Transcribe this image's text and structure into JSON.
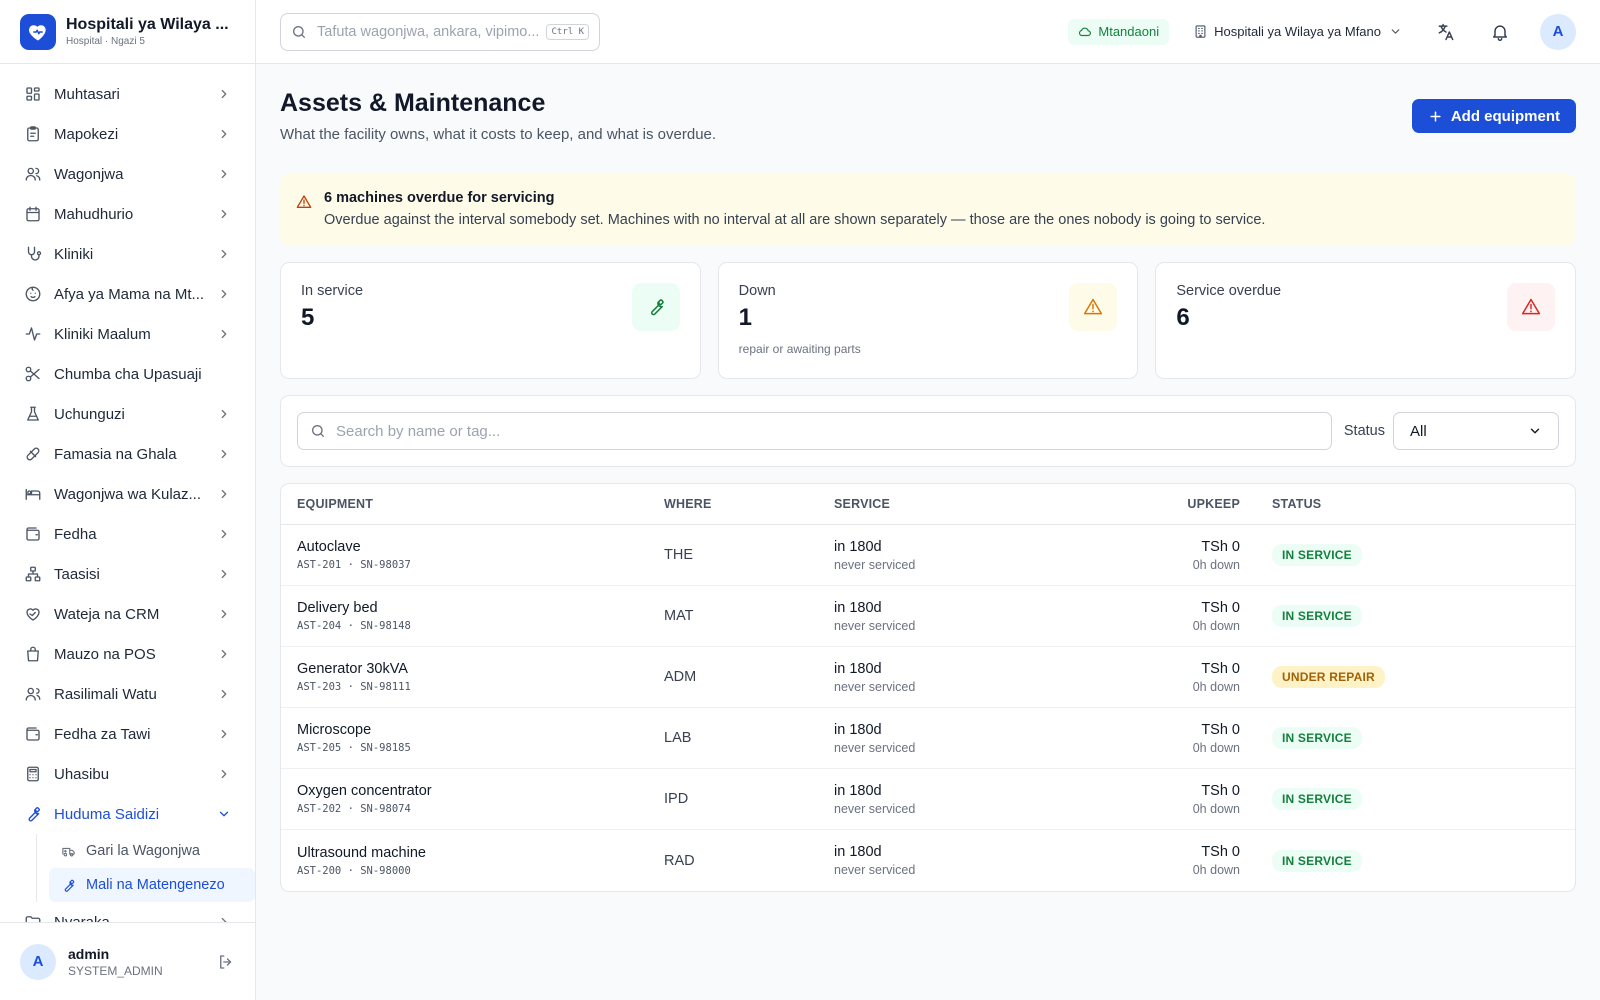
{
  "brand": {
    "title": "Hospitali ya Wilaya ...",
    "subtitle": "Hospital · Ngazi 5"
  },
  "sidebar": {
    "items": [
      {
        "label": "Muhtasari",
        "icon": "dashboard-icon",
        "chevron": true
      },
      {
        "label": "Mapokezi",
        "icon": "clipboard-icon",
        "chevron": true
      },
      {
        "label": "Wagonjwa",
        "icon": "users-icon",
        "chevron": true
      },
      {
        "label": "Mahudhurio",
        "icon": "calendar-icon",
        "chevron": true
      },
      {
        "label": "Kliniki",
        "icon": "stethoscope-icon",
        "chevron": true
      },
      {
        "label": "Afya ya Mama na Mt...",
        "icon": "baby-icon",
        "chevron": true
      },
      {
        "label": "Kliniki Maalum",
        "icon": "activity-icon",
        "chevron": true
      },
      {
        "label": "Chumba cha Upasuaji",
        "icon": "scissors-icon",
        "chevron": false
      },
      {
        "label": "Uchunguzi",
        "icon": "flask-icon",
        "chevron": true
      },
      {
        "label": "Famasia na Ghala",
        "icon": "pill-icon",
        "chevron": true
      },
      {
        "label": "Wagonjwa wa Kulaz...",
        "icon": "bed-icon",
        "chevron": true
      },
      {
        "label": "Fedha",
        "icon": "wallet-icon",
        "chevron": true
      },
      {
        "label": "Taasisi",
        "icon": "network-icon",
        "chevron": true
      },
      {
        "label": "Wateja na CRM",
        "icon": "heart-handshake-icon",
        "chevron": true
      },
      {
        "label": "Mauzo na POS",
        "icon": "shopping-bag-icon",
        "chevron": true
      },
      {
        "label": "Rasilimali Watu",
        "icon": "user-group-icon",
        "chevron": true
      },
      {
        "label": "Fedha za Tawi",
        "icon": "wallet-icon",
        "chevron": true
      },
      {
        "label": "Uhasibu",
        "icon": "calculator-icon",
        "chevron": true
      }
    ],
    "active_group": {
      "label": "Huduma Saidizi",
      "icon": "wrench-icon"
    },
    "sub_items": [
      {
        "label": "Gari la Wagonjwa",
        "icon": "ambulance-icon"
      },
      {
        "label": "Mali na Matengenezo",
        "icon": "wrench-icon",
        "active": true
      }
    ],
    "trailing_item": {
      "label": "Nyaraka",
      "icon": "folder-icon"
    }
  },
  "user": {
    "avatar": "A",
    "name": "admin",
    "role": "SYSTEM_ADMIN"
  },
  "topbar": {
    "search_placeholder": "Tafuta wagonjwa, ankara, vipimo...",
    "shortcut": "Ctrl K",
    "online_label": "Mtandaoni",
    "facility": "Hospitali ya Wilaya ya Mfano",
    "avatar": "A"
  },
  "page": {
    "title": "Assets & Maintenance",
    "subtitle": "What the facility owns, what it costs to keep, and what is overdue.",
    "add_button": "Add equipment"
  },
  "alert": {
    "title": "6 machines overdue for servicing",
    "body": "Overdue against the interval somebody set. Machines with no interval at all are shown separately — those are the ones nobody is going to service."
  },
  "stats": [
    {
      "label": "In service",
      "value": "5",
      "note": "",
      "icon": "wrench-icon",
      "color": "#15803d"
    },
    {
      "label": "Down",
      "value": "1",
      "note": "repair or awaiting parts",
      "icon": "warning-icon",
      "color": "#d97706"
    },
    {
      "label": "Service overdue",
      "value": "6",
      "note": "",
      "icon": "warning-icon",
      "color": "#dc2626"
    }
  ],
  "filter": {
    "search_placeholder": "Search by name or tag...",
    "status_label": "Status",
    "status_value": "All"
  },
  "table": {
    "columns": [
      "EQUIPMENT",
      "WHERE",
      "SERVICE",
      "UPKEEP",
      "STATUS"
    ],
    "rows": [
      {
        "name": "Autoclave",
        "tag": "AST-201 · SN-98037",
        "where": "THE",
        "service": "in 180d",
        "service_note": "never serviced",
        "upkeep": "TSh 0",
        "downtime": "0h down",
        "status": "IN SERVICE"
      },
      {
        "name": "Delivery bed",
        "tag": "AST-204 · SN-98148",
        "where": "MAT",
        "service": "in 180d",
        "service_note": "never serviced",
        "upkeep": "TSh 0",
        "downtime": "0h down",
        "status": "IN SERVICE"
      },
      {
        "name": "Generator 30kVA",
        "tag": "AST-203 · SN-98111",
        "where": "ADM",
        "service": "in 180d",
        "service_note": "never serviced",
        "upkeep": "TSh 0",
        "downtime": "0h down",
        "status": "UNDER REPAIR"
      },
      {
        "name": "Microscope",
        "tag": "AST-205 · SN-98185",
        "where": "LAB",
        "service": "in 180d",
        "service_note": "never serviced",
        "upkeep": "TSh 0",
        "downtime": "0h down",
        "status": "IN SERVICE"
      },
      {
        "name": "Oxygen concentrator",
        "tag": "AST-202 · SN-98074",
        "where": "IPD",
        "service": "in 180d",
        "service_note": "never serviced",
        "upkeep": "TSh 0",
        "downtime": "0h down",
        "status": "IN SERVICE"
      },
      {
        "name": "Ultrasound machine",
        "tag": "AST-200 · SN-98000",
        "where": "RAD",
        "service": "in 180d",
        "service_note": "never serviced",
        "upkeep": "TSh 0",
        "downtime": "0h down",
        "status": "IN SERVICE"
      }
    ]
  },
  "colors": {
    "accent": "#1d4ed8",
    "success": "#15803d",
    "warning": "#d97706",
    "danger": "#dc2626"
  }
}
